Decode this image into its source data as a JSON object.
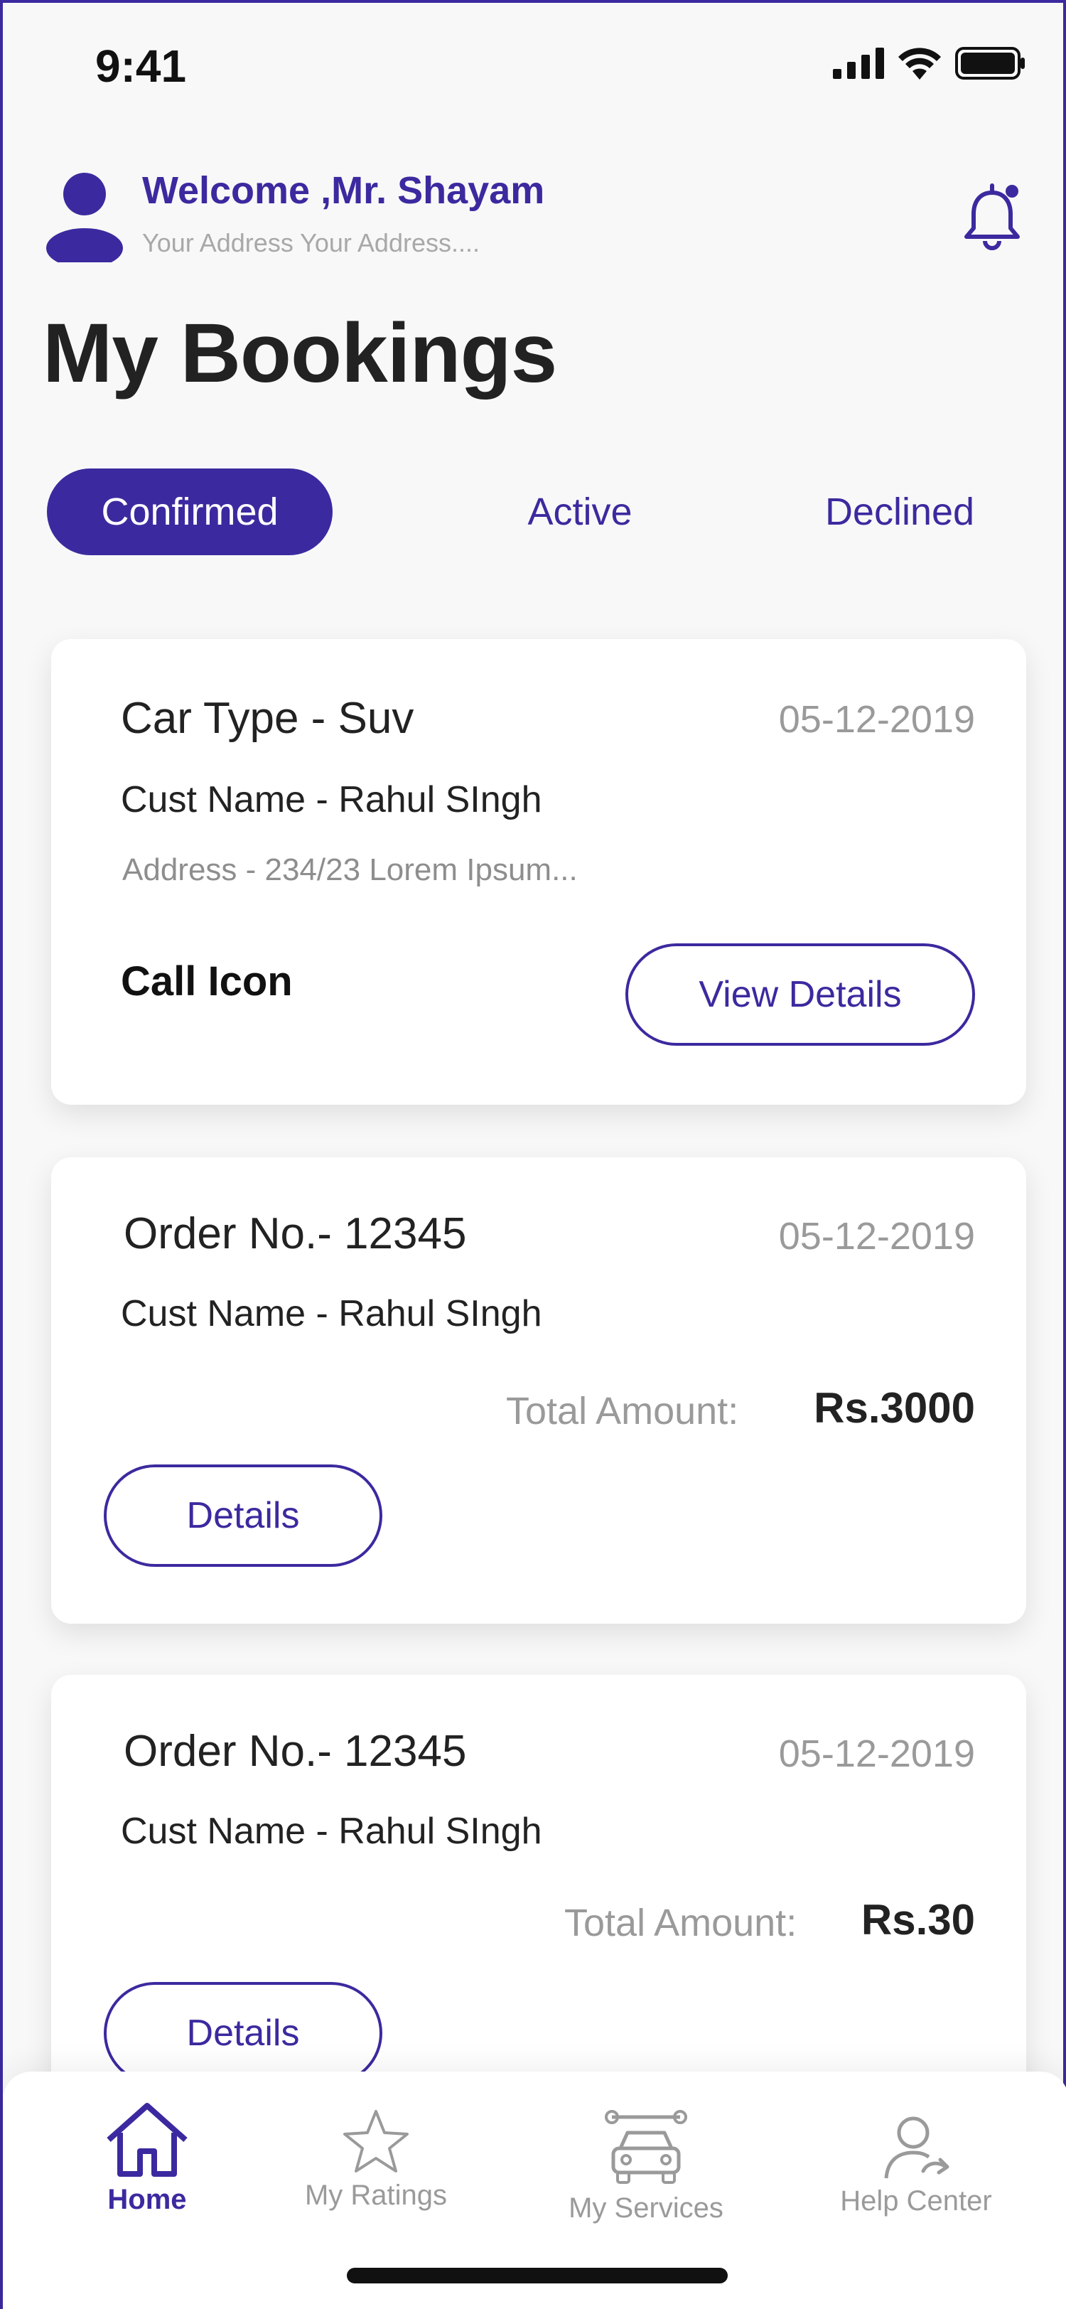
{
  "status_bar": {
    "time": "9:41"
  },
  "header": {
    "welcome": "Welcome ,Mr. Shayam",
    "address": "Your Address Your Address...."
  },
  "page_title": "My Bookings",
  "tabs": [
    {
      "label": "Confirmed",
      "active": true
    },
    {
      "label": "Active",
      "active": false
    },
    {
      "label": "Declined",
      "active": false
    }
  ],
  "cards": [
    {
      "title": "Car Type - Suv",
      "date": "05-12-2019",
      "customer": "Cust Name - Rahul SIngh",
      "address": "Address - 234/23 Lorem Ipsum...",
      "call_label": "Call Icon",
      "button": "View Details"
    },
    {
      "title": "Order No.- 12345",
      "date": "05-12-2019",
      "customer": "Cust Name - Rahul SIngh",
      "total_label": "Total Amount:",
      "total_value": "Rs.3000",
      "button": "Details"
    },
    {
      "title": "Order No.- 12345",
      "date": "05-12-2019",
      "customer": "Cust Name - Rahul SIngh",
      "total_label": "Total Amount:",
      "total_value": "Rs.30",
      "button": "Details"
    }
  ],
  "bottom_nav": [
    {
      "label": "Home",
      "icon": "home-icon",
      "active": true
    },
    {
      "label": "My Ratings",
      "icon": "star-icon",
      "active": false
    },
    {
      "label": "My Services",
      "icon": "car-service-icon",
      "active": false
    },
    {
      "label": "Help Center",
      "icon": "user-help-icon",
      "active": false
    }
  ],
  "colors": {
    "accent": "#3b2a9f",
    "muted": "#9a9a9a",
    "background": "#f8f8f8"
  }
}
